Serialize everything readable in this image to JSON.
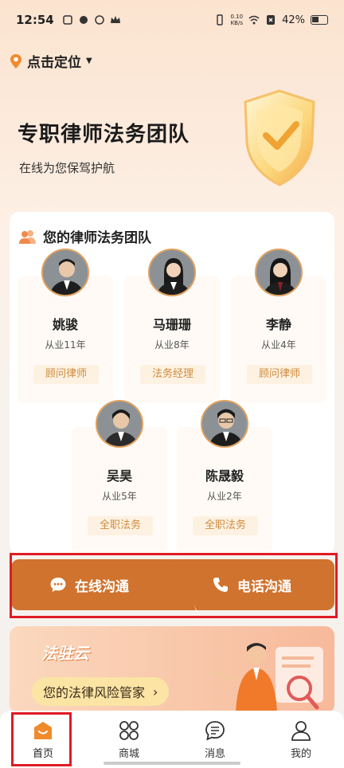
{
  "status_bar": {
    "time": "12:54",
    "net_speed_top": "0.10",
    "net_speed_bottom": "KB/s",
    "battery": "42%"
  },
  "location": {
    "label": "点击定位"
  },
  "hero": {
    "title": "专职律师法务团队",
    "subtitle": "在线为您保驾护航"
  },
  "team": {
    "header": "您的律师法务团队",
    "members": [
      {
        "name": "姚骏",
        "years": "从业11年",
        "role": "顾问律师"
      },
      {
        "name": "马珊珊",
        "years": "从业8年",
        "role": "法务经理"
      },
      {
        "name": "李静",
        "years": "从业4年",
        "role": "顾问律师"
      },
      {
        "name": "吴昊",
        "years": "从业5年",
        "role": "全职法务"
      },
      {
        "name": "陈晟毅",
        "years": "从业2年",
        "role": "全职法务"
      }
    ]
  },
  "actions": {
    "online": "在线沟通",
    "phone": "电话沟通"
  },
  "promo": {
    "title": "法驻云",
    "pill": "您的法律风险管家"
  },
  "tabbar": {
    "items": [
      {
        "label": "首页",
        "icon": "home-icon",
        "active": true
      },
      {
        "label": "商城",
        "icon": "grid-icon",
        "active": false
      },
      {
        "label": "消息",
        "icon": "message-icon",
        "active": false
      },
      {
        "label": "我的",
        "icon": "user-icon",
        "active": false
      }
    ]
  },
  "colors": {
    "accent": "#d0732e",
    "role_text": "#d08a3c",
    "highlight": "#e01b24"
  }
}
